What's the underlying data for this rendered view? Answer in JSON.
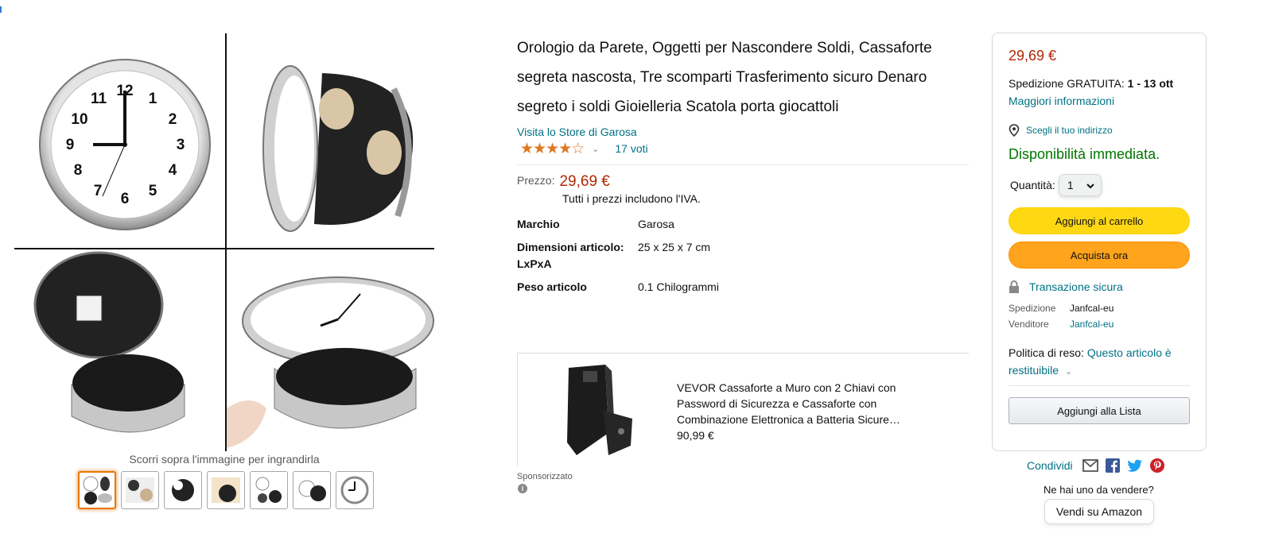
{
  "product": {
    "title": "Orologio da Parete, Oggetti per Nascondere Soldi, Cassaforte segreta nascosta, Tre scomparti Trasferimento sicuro Denaro segreto i soldi Gioielleria Scatola porta giocattoli",
    "store_link": "Visita lo Store di Garosa",
    "rating_stars": 3.5,
    "rating_glyphs": "★★★★☆",
    "ratings_count": "17 voti",
    "price_label": "Prezzo:",
    "price": "29,69 €",
    "vat_note": "Tutti i prezzi includono l'IVA.",
    "specs": [
      {
        "key": "Marchio",
        "value": "Garosa"
      },
      {
        "key": "Dimensioni articolo: LxPxA",
        "value": "25 x 25 x 7 cm"
      },
      {
        "key": "Peso articolo",
        "value": "0.1 Chilogrammi"
      }
    ]
  },
  "gallery": {
    "hover_hint": "Scorri sopra l'immagine per ingrandirla",
    "thumbnails_count": 7,
    "active_thumbnail": 0
  },
  "sponsored": {
    "title": "VEVOR Cassaforte a Muro con 2 Chiavi con Password di Sicurezza e Cassaforte con Combinazione Elettronica a Batteria Sicure…",
    "price": "90,99 €",
    "label": "Sponsorizzato",
    "info_glyph": "i"
  },
  "buybox": {
    "price": "29,69 €",
    "shipping_prefix": "Spedizione GRATUITA: ",
    "shipping_dates": "1 - 13 ott",
    "shipping_more": "Maggiori informazioni",
    "address_link": "Scegli il tuo indirizzo",
    "availability": "Disponibilità immediata.",
    "qty_label": "Quantità:",
    "qty_value": "1",
    "add_to_cart": "Aggiungi al carrello",
    "buy_now": "Acquista ora",
    "secure": "Transazione sicura",
    "ships_from_label": "Spedizione",
    "ships_from": "Janfcal-eu",
    "sold_by_label": "Venditore",
    "sold_by": "Janfcal-eu",
    "return_label": "Politica di reso: ",
    "return_link": "Questo articolo è restituibile",
    "add_to_list": "Aggiungi alla Lista"
  },
  "share": {
    "label": "Condividi"
  },
  "sell": {
    "question": "Ne hai uno da vendere?",
    "button": "Vendi su Amazon"
  },
  "colors": {
    "price": "#b12704",
    "link": "#007185",
    "avail": "#007600",
    "cart": "#ffd814",
    "buy": "#ffa41c",
    "star": "#de7921"
  }
}
